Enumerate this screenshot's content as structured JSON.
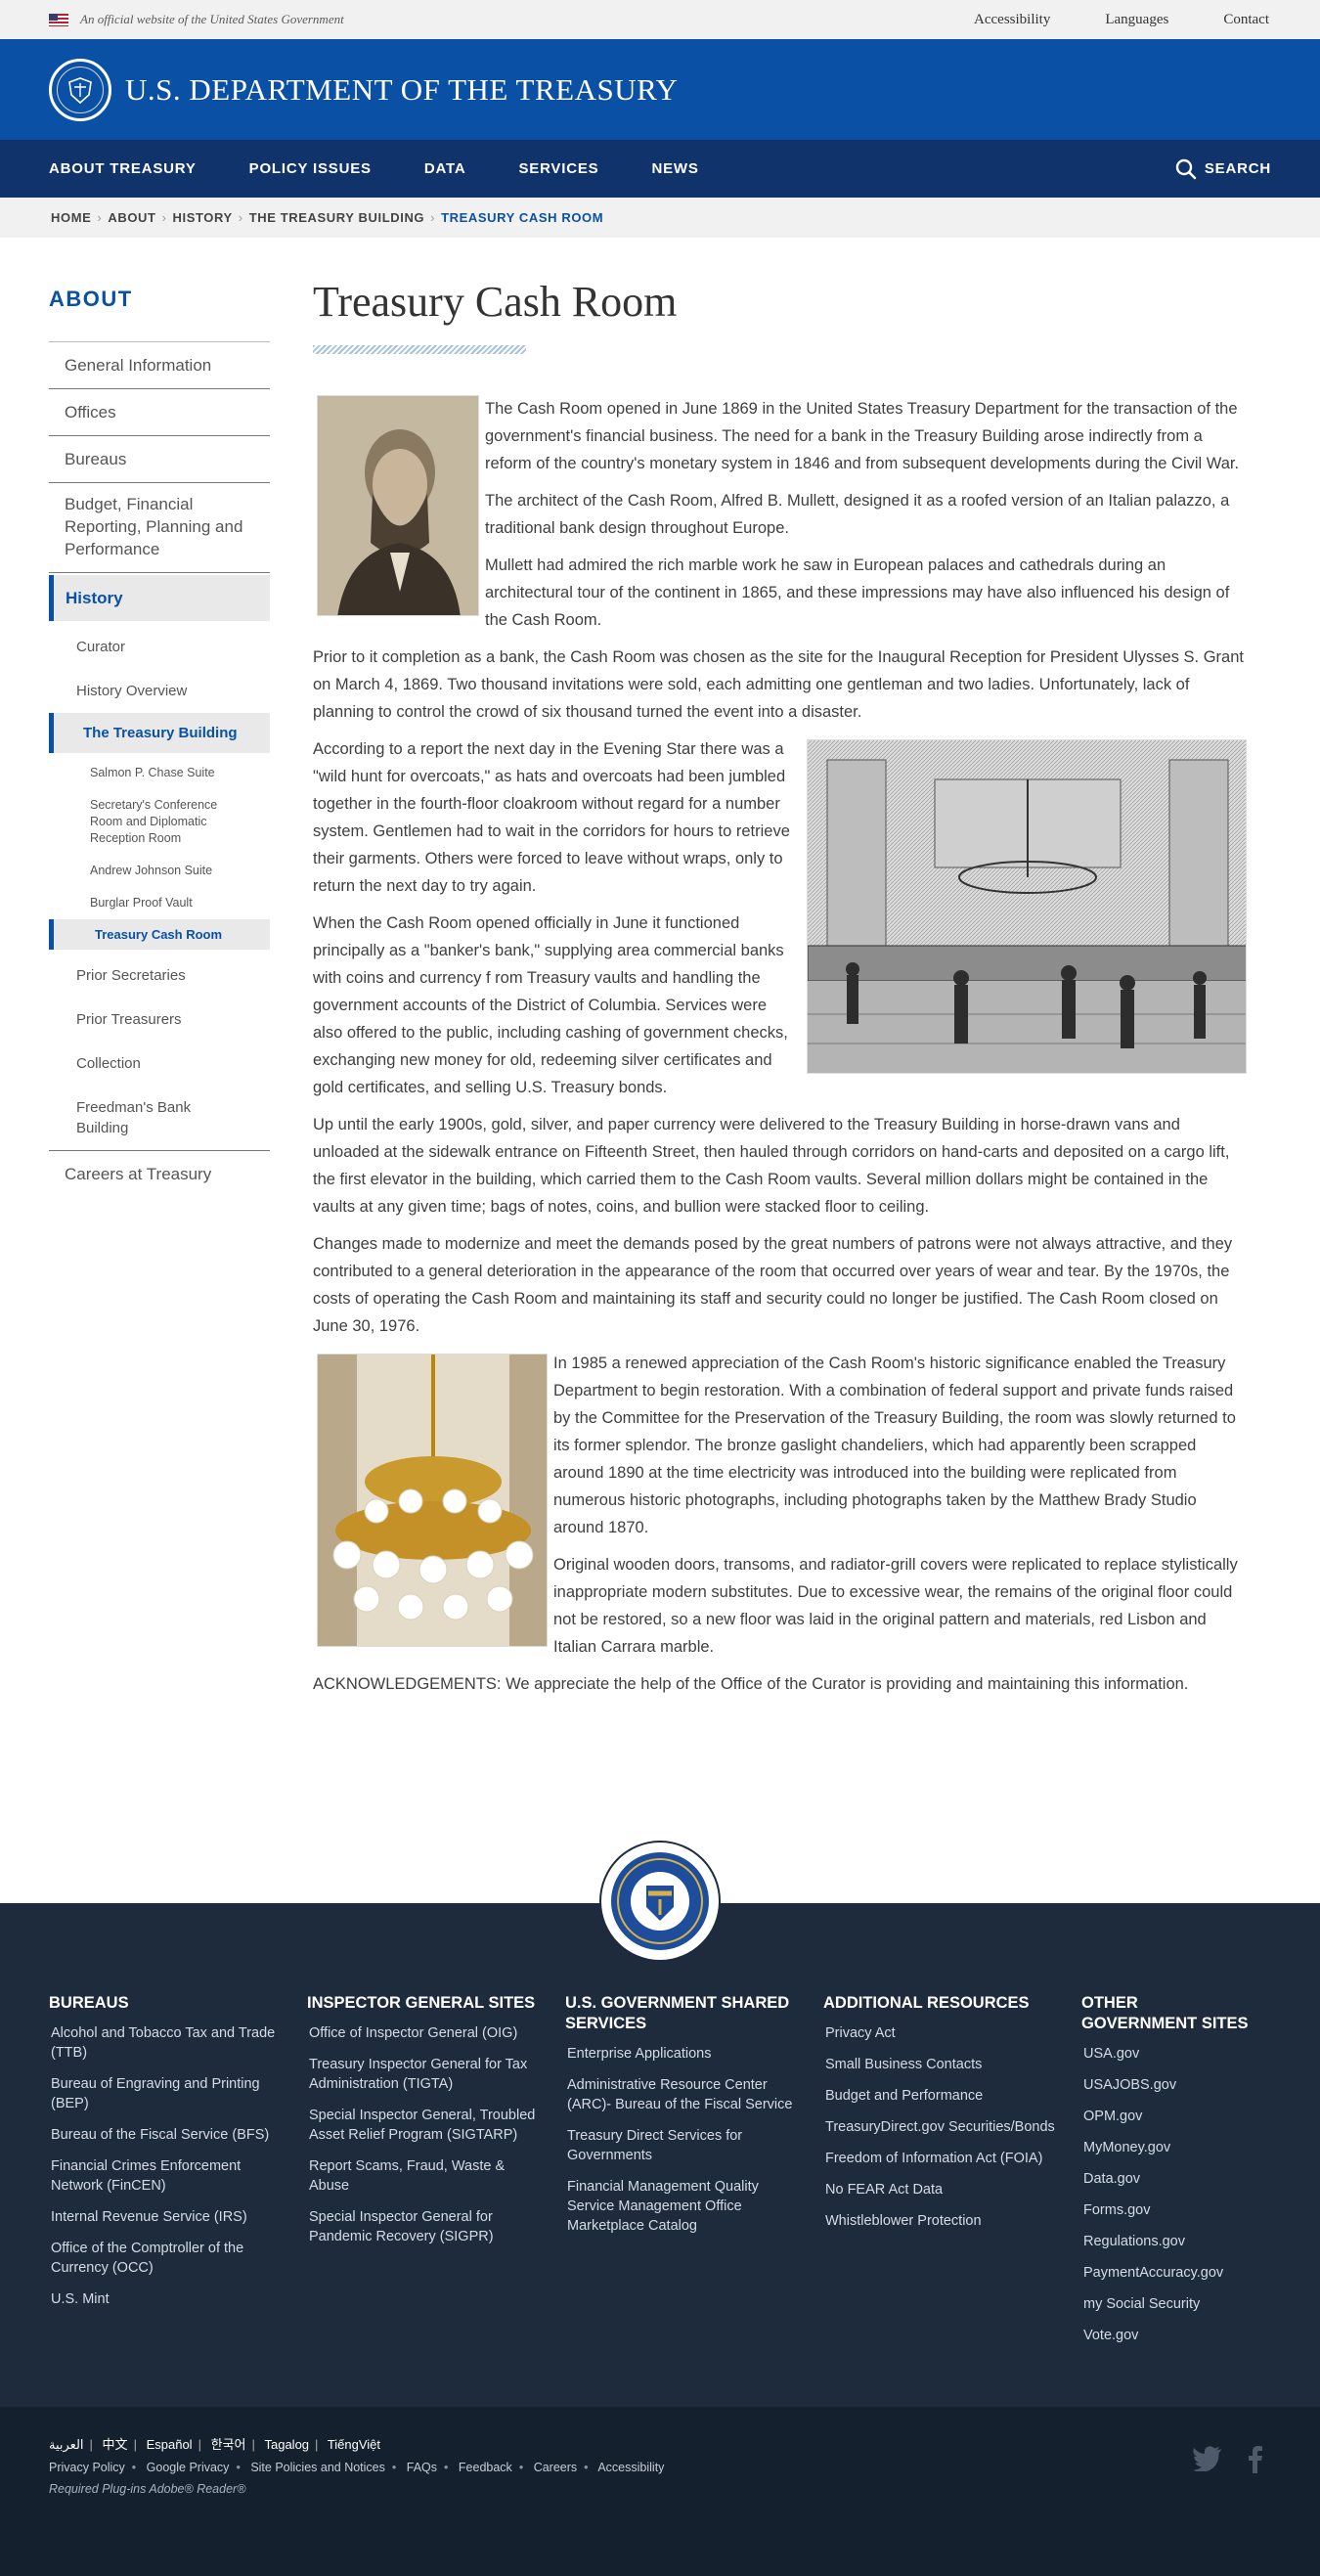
{
  "banner": {
    "official": "An official website of the United States Government",
    "links": [
      "Accessibility",
      "Languages",
      "Contact"
    ]
  },
  "header": {
    "title": "U.S. DEPARTMENT OF THE TREASURY"
  },
  "nav": {
    "items": [
      "ABOUT TREASURY",
      "POLICY ISSUES",
      "DATA",
      "SERVICES",
      "NEWS"
    ],
    "search": "SEARCH"
  },
  "breadcrumb": [
    "HOME",
    "ABOUT",
    "HISTORY",
    "THE TREASURY BUILDING",
    "TREASURY CASH ROOM"
  ],
  "sidebar": {
    "heading": "ABOUT",
    "items": [
      "General Information",
      "Offices",
      "Bureaus",
      "Budget, Financial Reporting, Planning and Performance"
    ],
    "history": "History",
    "history_items": [
      "Curator",
      "History Overview"
    ],
    "treasury_building": "The Treasury Building",
    "building_items": [
      "Salmon P. Chase Suite",
      "Secretary's Conference Room and Diplomatic Reception Room",
      "Andrew Johnson Suite",
      "Burglar Proof Vault"
    ],
    "building_active": "Treasury Cash Room",
    "history_items_after": [
      "Prior Secretaries",
      "Prior Treasurers",
      "Collection",
      "Freedman's Bank Building"
    ],
    "careers": "Careers at Treasury"
  },
  "main": {
    "title": "Treasury Cash Room",
    "paragraphs": [
      "The Cash Room opened in June 1869 in the United States Treasury Department for the transaction of the government's financial business. The need for a bank in the Treasury Building arose indirectly from a reform of the country's monetary system in 1846 and from subsequent developments during the Civil War.",
      "The architect of the Cash Room, Alfred B. Mullett, designed it as a roofed version of an Italian palazzo, a traditional bank design throughout Europe.",
      "Mullett had admired the rich marble work he saw in European palaces and cathedrals during an architectural tour of the continent in 1865, and these impressions may have also influenced his design of the Cash Room.",
      "Prior to it completion as a bank, the Cash Room was chosen as the site for the Inaugural Reception for President Ulysses S. Grant on March 4, 1869. Two thousand invitations were sold, each admitting one gentleman and two ladies. Unfortunately, lack of planning to control the crowd of six thousand turned the event into a disaster.",
      "According to a report the next day in the Evening Star there was a \"wild hunt for overcoats,\" as hats and overcoats had been jumbled together in the fourth-floor cloakroom without regard for a number system. Gentlemen had to wait in the corridors for hours to retrieve their garments. Others were forced to leave without wraps, only to return the next day to try again.",
      "When the Cash Room opened officially in June it functioned principally as a \"banker's bank,\" supplying area commercial banks with coins and currency f rom Treasury vaults and handling the government accounts of the District of Columbia. Services were also offered to the public, including cashing of government checks, exchanging new money for old, redeeming silver certificates and gold certificates, and selling U.S. Treasury bonds.",
      "Up until the early 1900s, gold, silver, and paper currency were delivered to the Treasury Building in horse-drawn vans and unloaded at the sidewalk entrance on Fifteenth Street, then hauled through corridors on hand-carts and deposited on a cargo lift, the first elevator in the building, which carried them to the Cash Room vaults. Several million dollars might be contained in the vaults at any given time; bags of notes, coins, and bullion were stacked floor to ceiling.",
      "Changes made to modernize and meet the demands posed by the great numbers of patrons were not always attractive, and they contributed to a general deterioration in the appearance of the room that occurred over years of wear and tear. By the 1970s, the costs of operating the Cash Room and maintaining its staff and security could no longer be justified. The Cash Room closed on June 30, 1976.",
      "In 1985 a renewed appreciation of the Cash Room's historic significance enabled the Treasury Department to begin restoration. With a combination of federal support and private funds raised by the Committee for the Preservation of the Treasury Building, the room was slowly returned to its former splendor. The bronze gaslight chandeliers, which had apparently been scrapped around 1890 at the time electricity was introduced into the building were replicated from numerous historic photographs, including photographs taken by the Matthew Brady Studio around 1870.",
      "Original wooden doors, transoms, and radiator-grill covers were replicated to replace stylistically inappropriate modern substitutes. Due to excessive wear, the remains of the original floor could not be restored, so a new floor was laid in the original pattern and materials, red Lisbon and Italian Carrara marble.",
      "ACKNOWLEDGEMENTS: We appreciate the help of the Office of the Curator is providing and maintaining this information."
    ]
  },
  "footer": {
    "columns": [
      {
        "heading": "BUREAUS",
        "links": [
          "Alcohol and Tobacco Tax and Trade (TTB)",
          "Bureau of Engraving and Printing (BEP)",
          "Bureau of the Fiscal Service (BFS)",
          "Financial Crimes Enforcement Network (FinCEN)",
          "Internal Revenue Service (IRS)",
          "Office of the Comptroller of the Currency (OCC)",
          "U.S. Mint"
        ]
      },
      {
        "heading": "INSPECTOR GENERAL SITES",
        "links": [
          "Office of Inspector General (OIG)",
          "Treasury Inspector General for Tax Administration (TIGTA)",
          "Special Inspector General, Troubled Asset Relief Program (SIGTARP)",
          "Report Scams, Fraud, Waste & Abuse",
          "Special Inspector General for Pandemic Recovery (SIGPR)"
        ]
      },
      {
        "heading": "U.S. GOVERNMENT SHARED SERVICES",
        "links": [
          "Enterprise Applications",
          "Administrative Resource Center (ARC)- Bureau of the Fiscal Service",
          "Treasury Direct Services for Governments",
          "Financial Management Quality Service Management Office Marketplace Catalog"
        ]
      },
      {
        "heading": "ADDITIONAL RESOURCES",
        "links": [
          "Privacy Act",
          "Small Business Contacts",
          "Budget and Performance",
          "TreasuryDirect.gov Securities/Bonds",
          "Freedom of Information Act (FOIA)",
          "No FEAR Act Data",
          "Whistleblower Protection"
        ]
      },
      {
        "heading": "OTHER GOVERNMENT SITES",
        "links": [
          "USA.gov",
          "USAJOBS.gov",
          "OPM.gov",
          "MyMoney.gov",
          "Data.gov",
          "Forms.gov",
          "Regulations.gov",
          "PaymentAccuracy.gov",
          "my Social Security",
          "Vote.gov"
        ]
      }
    ],
    "languages": [
      "العربية",
      "中文",
      "Español",
      "한국어",
      "Tagalog",
      "TiếngViệt"
    ],
    "legal": [
      "Privacy Policy",
      "Google Privacy",
      "Site Policies and Notices",
      "FAQs",
      "Feedback",
      "Careers",
      "Accessibility"
    ],
    "plugins": "Required Plug-ins  Adobe® Reader®"
  },
  "colors": {
    "header_blue": "#0a50a4",
    "nav_navy": "#11336c",
    "footer": "#1d2b3c"
  }
}
